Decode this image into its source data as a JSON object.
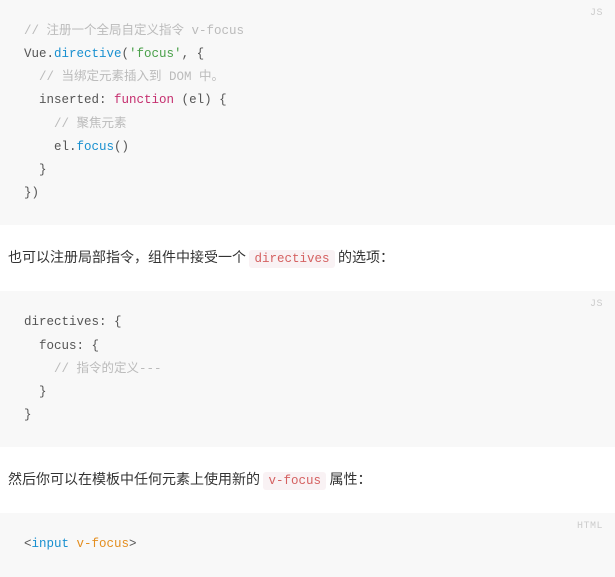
{
  "blocks": {
    "code1": {
      "lang": "JS",
      "lines": [
        {
          "type": "comment",
          "text": "// 注册一个全局自定义指令 v-focus"
        },
        {
          "type": "line",
          "segments": [
            {
              "c": "plain",
              "t": "Vue."
            },
            {
              "c": "func",
              "t": "directive"
            },
            {
              "c": "plain",
              "t": "("
            },
            {
              "c": "string",
              "t": "'focus'"
            },
            {
              "c": "plain",
              "t": ", {"
            }
          ]
        },
        {
          "type": "line",
          "indent": "  ",
          "segments": [
            {
              "c": "comment",
              "t": "// 当绑定元素插入到 DOM 中。"
            }
          ]
        },
        {
          "type": "line",
          "indent": "  ",
          "segments": [
            {
              "c": "plain",
              "t": "inserted: "
            },
            {
              "c": "keyword",
              "t": "function"
            },
            {
              "c": "plain",
              "t": " ("
            },
            {
              "c": "plain",
              "t": "el"
            },
            {
              "c": "plain",
              "t": ") {"
            }
          ]
        },
        {
          "type": "line",
          "indent": "    ",
          "segments": [
            {
              "c": "comment",
              "t": "// 聚焦元素"
            }
          ]
        },
        {
          "type": "line",
          "indent": "    ",
          "segments": [
            {
              "c": "plain",
              "t": "el."
            },
            {
              "c": "func",
              "t": "focus"
            },
            {
              "c": "plain",
              "t": "()"
            }
          ]
        },
        {
          "type": "line",
          "indent": "  ",
          "segments": [
            {
              "c": "plain",
              "t": "}"
            }
          ]
        },
        {
          "type": "line",
          "segments": [
            {
              "c": "plain",
              "t": "})"
            }
          ]
        }
      ]
    },
    "para1": {
      "before": "也可以注册局部指令，组件中接受一个 ",
      "code": "directives",
      "after": " 的选项："
    },
    "code2": {
      "lang": "JS",
      "lines": [
        {
          "type": "line",
          "segments": [
            {
              "c": "plain",
              "t": "directives: {"
            }
          ]
        },
        {
          "type": "line",
          "indent": "  ",
          "segments": [
            {
              "c": "plain",
              "t": "focus: {"
            }
          ]
        },
        {
          "type": "line",
          "indent": "    ",
          "segments": [
            {
              "c": "comment",
              "t": "// 指令的定义---"
            }
          ]
        },
        {
          "type": "line",
          "segments": [
            {
              "c": "plain",
              "t": ""
            }
          ]
        },
        {
          "type": "line",
          "indent": "  ",
          "segments": [
            {
              "c": "plain",
              "t": "}"
            }
          ]
        },
        {
          "type": "line",
          "segments": [
            {
              "c": "plain",
              "t": "}"
            }
          ]
        }
      ]
    },
    "para2": {
      "before": "然后你可以在模板中任何元素上使用新的 ",
      "code": "v-focus",
      "after": " 属性："
    },
    "code3": {
      "lang": "HTML",
      "html_line": {
        "open": "<",
        "tag": "input",
        "attr": " v-focus",
        "close": ">"
      }
    }
  }
}
